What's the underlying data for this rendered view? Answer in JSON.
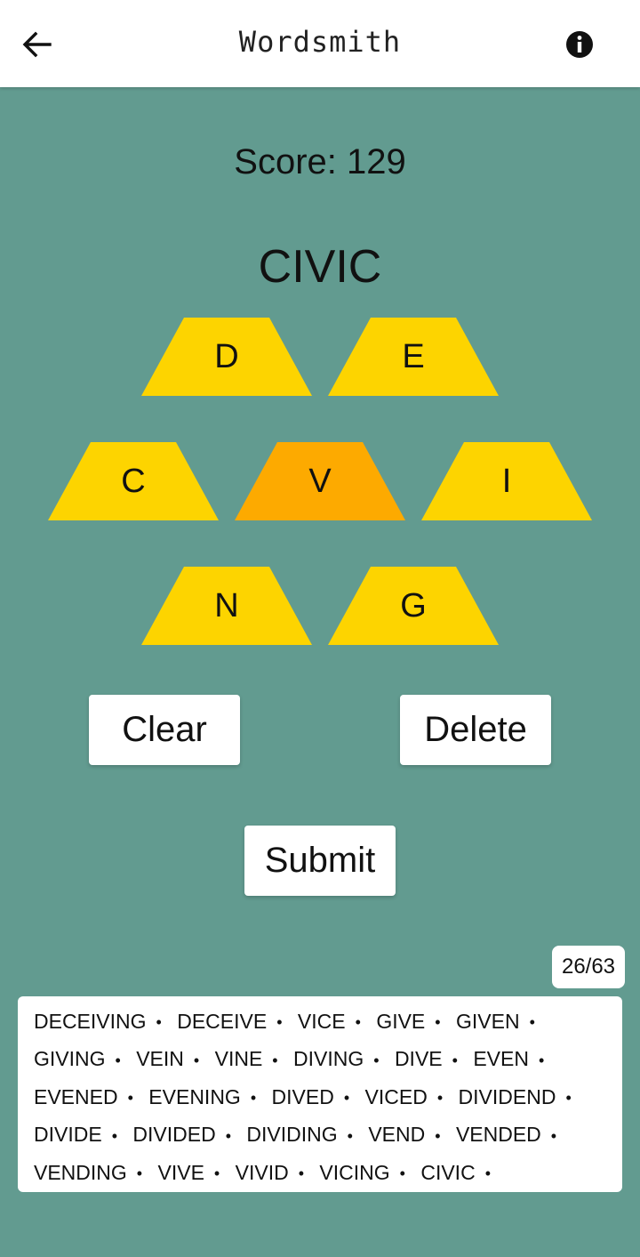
{
  "app": {
    "title": "Wordsmith"
  },
  "header": {
    "back_icon": "arrow-left-icon",
    "info_icon": "info-circle-icon"
  },
  "game": {
    "score_text": "Score: 129",
    "current_word": "CIVIC",
    "tiles": [
      {
        "letter": "D",
        "selected": false
      },
      {
        "letter": "E",
        "selected": false
      },
      {
        "letter": "C",
        "selected": false
      },
      {
        "letter": "V",
        "selected": true
      },
      {
        "letter": "I",
        "selected": false
      },
      {
        "letter": "N",
        "selected": false
      },
      {
        "letter": "G",
        "selected": false
      }
    ],
    "colors": {
      "tile": "#fdd400",
      "tile_center": "#fdaa00",
      "background": "#629b90"
    }
  },
  "buttons": {
    "clear": "Clear",
    "delete": "Delete",
    "submit": "Submit"
  },
  "found": {
    "counter": "26/63",
    "words": [
      "DECEIVING",
      "DECEIVE",
      "VICE",
      "GIVE",
      "GIVEN",
      "GIVING",
      "VEIN",
      "VINE",
      "DIVING",
      "DIVE",
      "EVEN",
      "EVENED",
      "EVENING",
      "DIVED",
      "VICED",
      "DIVIDEND",
      "DIVIDE",
      "DIVIDED",
      "DIVIDING",
      "VEND",
      "VENDED",
      "VENDING",
      "VIVE",
      "VIVID",
      "VICING",
      "CIVIC"
    ]
  }
}
